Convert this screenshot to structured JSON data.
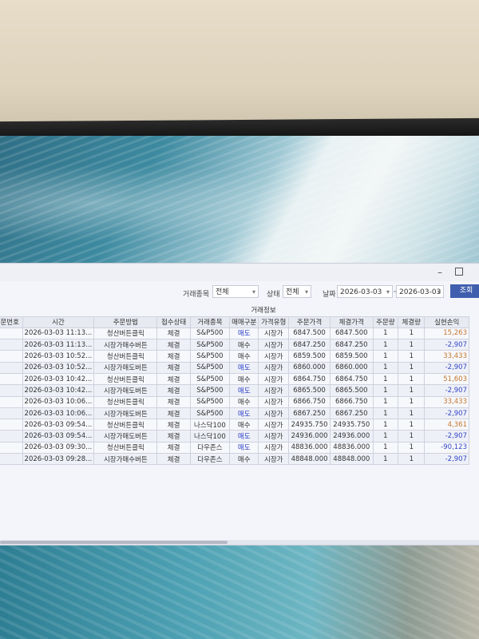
{
  "filters": {
    "symbol_label": "거래종목",
    "symbol_value": "전체",
    "status_label": "상태",
    "status_value": "전체",
    "date_label": "날짜",
    "date_from": "2026-03-03",
    "date_to": "2026-03-03",
    "search_button": "조회"
  },
  "table": {
    "group_header": "거래정보",
    "columns": [
      "주문번호",
      "시간",
      "주문방법",
      "접수상태",
      "거래종목",
      "매매구분",
      "가격유형",
      "주문가격",
      "체결가격",
      "주문량",
      "체결량",
      "실현손익"
    ],
    "rows": [
      [
        "",
        "2026-03-03 11:13...",
        "청산버튼클릭",
        "체결",
        "S&P500",
        "매도",
        "시장가",
        "6847.500",
        "6847.500",
        "1",
        "1",
        "15,263"
      ],
      [
        "",
        "2026-03-03 11:13...",
        "시장가매수버튼",
        "체결",
        "S&P500",
        "매수",
        "시장가",
        "6847.250",
        "6847.250",
        "1",
        "1",
        "-2,907"
      ],
      [
        "",
        "2026-03-03 10:52...",
        "청산버튼클릭",
        "체결",
        "S&P500",
        "매수",
        "시장가",
        "6859.500",
        "6859.500",
        "1",
        "1",
        "33,433"
      ],
      [
        "",
        "2026-03-03 10:52...",
        "시장가매도버튼",
        "체결",
        "S&P500",
        "매도",
        "시장가",
        "6860.000",
        "6860.000",
        "1",
        "1",
        "-2,907"
      ],
      [
        "",
        "2026-03-03 10:42...",
        "청산버튼클릭",
        "체결",
        "S&P500",
        "매수",
        "시장가",
        "6864.750",
        "6864.750",
        "1",
        "1",
        "51,603"
      ],
      [
        "",
        "2026-03-03 10:42...",
        "시장가매도버튼",
        "체결",
        "S&P500",
        "매도",
        "시장가",
        "6865.500",
        "6865.500",
        "1",
        "1",
        "-2,907"
      ],
      [
        "",
        "2026-03-03 10:06...",
        "청산버튼클릭",
        "체결",
        "S&P500",
        "매수",
        "시장가",
        "6866.750",
        "6866.750",
        "1",
        "1",
        "33,433"
      ],
      [
        "",
        "2026-03-03 10:06...",
        "시장가매도버튼",
        "체결",
        "S&P500",
        "매도",
        "시장가",
        "6867.250",
        "6867.250",
        "1",
        "1",
        "-2,907"
      ],
      [
        "",
        "2026-03-03 09:54...",
        "청산버튼클릭",
        "체결",
        "나스닥100",
        "매수",
        "시장가",
        "24935.750",
        "24935.750",
        "1",
        "1",
        "4,361"
      ],
      [
        "",
        "2026-03-03 09:54...",
        "시장가매도버튼",
        "체결",
        "나스닥100",
        "매도",
        "시장가",
        "24936.000",
        "24936.000",
        "1",
        "1",
        "-2,907"
      ],
      [
        "",
        "2026-03-03 09:30...",
        "청산버튼클릭",
        "체결",
        "다우존스",
        "매도",
        "시장가",
        "48836.000",
        "48836.000",
        "1",
        "1",
        "-90,123"
      ],
      [
        "",
        "2026-03-03 09:28...",
        "시장가매수버튼",
        "체결",
        "다우존스",
        "매수",
        "시장가",
        "48848.000",
        "48848.000",
        "1",
        "1",
        "-2,907"
      ]
    ]
  },
  "colors": {
    "sell": "#2a3fc9",
    "loss": "#3347c7",
    "profit": "#c6762c",
    "button": "#3f5fae"
  }
}
